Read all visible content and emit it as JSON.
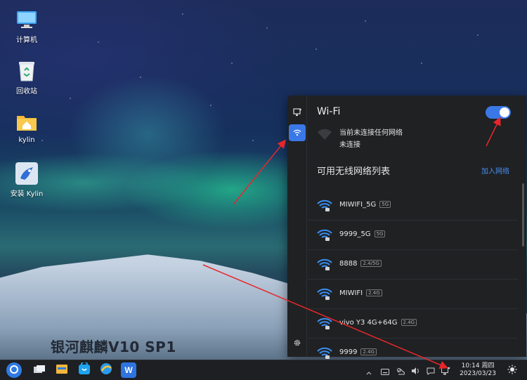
{
  "desktop": {
    "icons": [
      {
        "label": "计算机",
        "icon": "computer-icon"
      },
      {
        "label": "回收站",
        "icon": "trash-icon"
      },
      {
        "label": "kylin",
        "icon": "home-folder-icon"
      },
      {
        "label": "安装 Kylin",
        "icon": "installer-icon"
      }
    ],
    "watermark": "银河麒麟V10 SP1"
  },
  "network_panel": {
    "title": "Wi-Fi",
    "wifi_enabled": true,
    "current_status_line1": "当前未连接任何网络",
    "current_status_line2": "未连接",
    "list_title": "可用无线网络列表",
    "add_network_label": "加入网络",
    "networks": [
      {
        "ssid": "MIWIFI_5G",
        "band": "5G",
        "secured": true
      },
      {
        "ssid": "9999_5G",
        "band": "5G",
        "secured": true
      },
      {
        "ssid": "8888",
        "band": "2.4/5G",
        "secured": true
      },
      {
        "ssid": "MIWIFI",
        "band": "2.4G",
        "secured": true
      },
      {
        "ssid": "vivo Y3 4G+64G",
        "band": "2.4G",
        "secured": true
      },
      {
        "ssid": "9999",
        "band": "2.4G",
        "secured": true
      }
    ],
    "colors": {
      "accent": "#3b78e7",
      "panel_bg": "#1f2123"
    }
  },
  "taskbar": {
    "apps": [
      "start-menu-icon",
      "multitask-view-icon",
      "file-manager-icon",
      "software-store-icon",
      "browser-icon",
      "wps-icon"
    ],
    "clock_time": "10:14 周四",
    "clock_date": "2023/03/23"
  }
}
